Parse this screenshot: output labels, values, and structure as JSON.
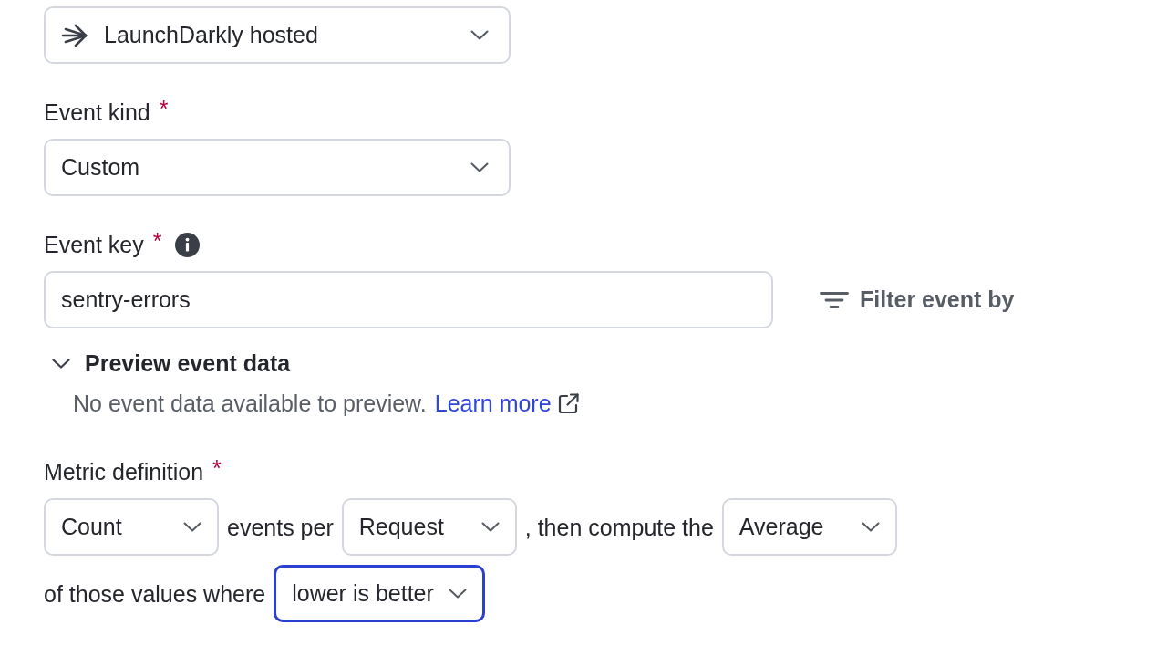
{
  "source_dropdown": {
    "value": "LaunchDarkly hosted"
  },
  "fields": [
    {
      "kind": "select",
      "label": "Event kind",
      "required_mark": "*",
      "value": "Custom"
    },
    {
      "kind": "text",
      "label": "Event key",
      "required_mark": "*",
      "info": true,
      "value": "sentry-errors",
      "action": "Filter event by"
    }
  ],
  "preview": {
    "title": "Preview event data",
    "expanded": true,
    "message": "No event data available to preview.",
    "link": "Learn more"
  },
  "metric_definition": {
    "label": "Metric definition",
    "required_mark": "*",
    "lines": [
      [
        {
          "kind": "select",
          "value": "Count",
          "focused": false
        },
        {
          "kind": "text",
          "text": "events per"
        },
        {
          "kind": "select",
          "value": "Request",
          "focused": false
        },
        {
          "kind": "text",
          "text": ", then compute the"
        },
        {
          "kind": "select",
          "value": "Average",
          "focused": false
        }
      ],
      [
        {
          "kind": "text",
          "text": "of those values where"
        },
        {
          "kind": "select",
          "value": "lower is better",
          "focused": true
        }
      ]
    ]
  }
}
